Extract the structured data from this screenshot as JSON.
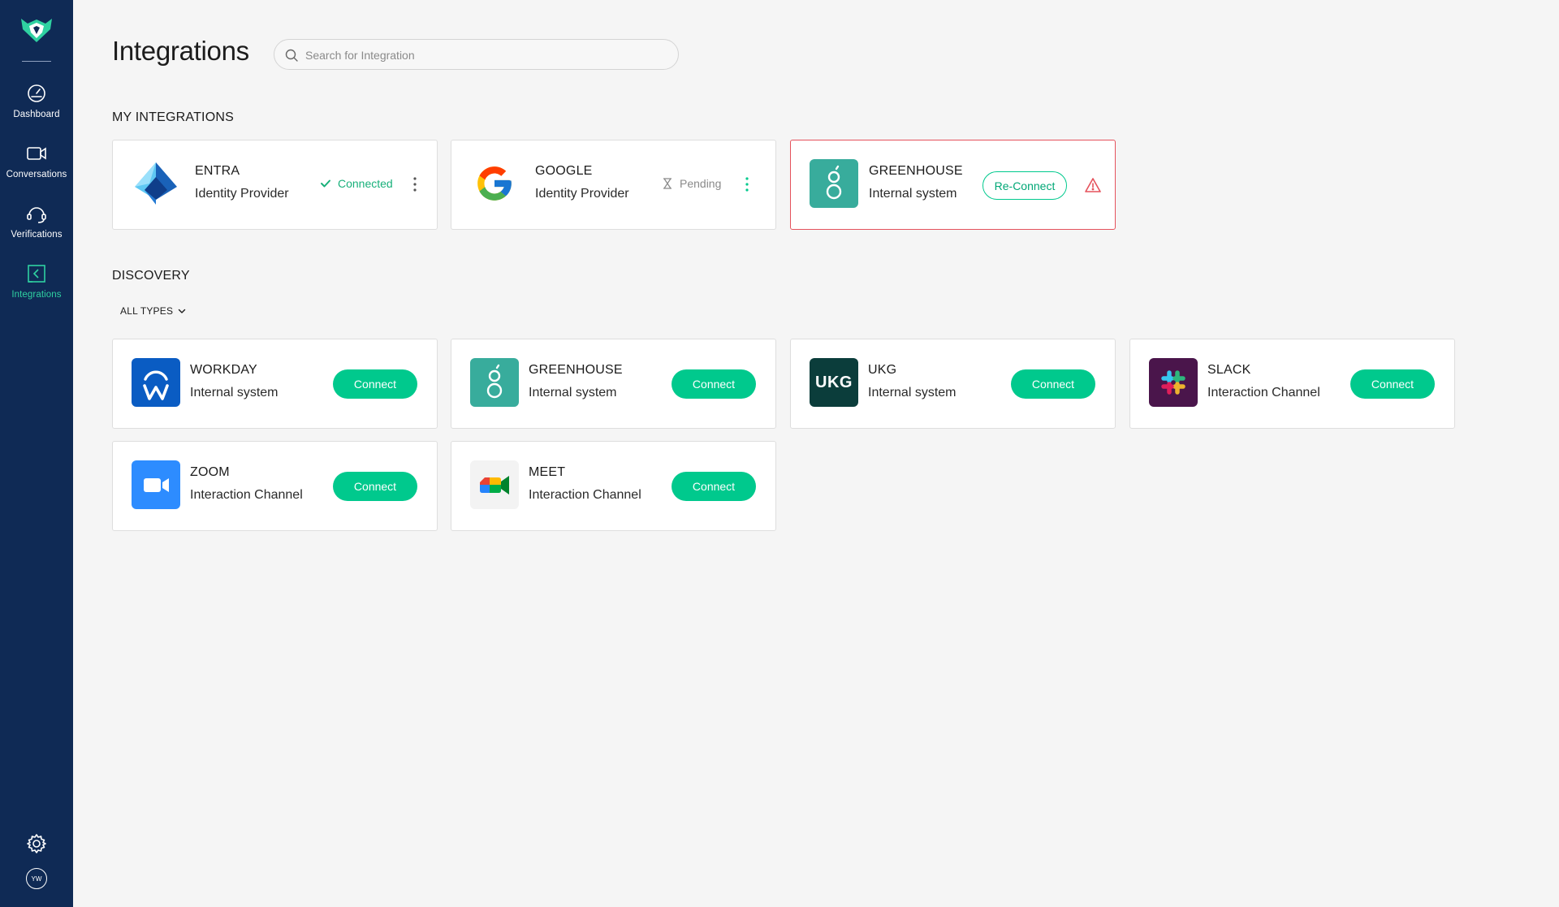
{
  "sidebar": {
    "items": [
      {
        "label": "Dashboard",
        "icon": "gauge-icon"
      },
      {
        "label": "Conversations",
        "icon": "video-camera-icon"
      },
      {
        "label": "Verifications",
        "icon": "headset-icon"
      },
      {
        "label": "Integrations",
        "icon": "integrations-icon",
        "active": true
      }
    ],
    "avatar_initials": "YW"
  },
  "header": {
    "title": "Integrations",
    "search_placeholder": "Search for Integration"
  },
  "my_integrations": {
    "title": "MY INTEGRATIONS",
    "cards": [
      {
        "name": "ENTRA",
        "type": "Identity Provider",
        "status": "Connected"
      },
      {
        "name": "GOOGLE",
        "type": "Identity Provider",
        "status": "Pending"
      },
      {
        "name": "GREENHOUSE",
        "type": "Internal system",
        "action": "Re-Connect"
      }
    ]
  },
  "discovery": {
    "title": "DISCOVERY",
    "filter_label": "ALL TYPES",
    "connect_label": "Connect",
    "cards": [
      {
        "name": "WORKDAY",
        "type": "Internal system"
      },
      {
        "name": "GREENHOUSE",
        "type": "Internal system"
      },
      {
        "name": "UKG",
        "type": "Internal system",
        "logo_text": "UKG"
      },
      {
        "name": "SLACK",
        "type": "Interaction Channel"
      },
      {
        "name": "ZOOM",
        "type": "Interaction Channel"
      },
      {
        "name": "MEET",
        "type": "Interaction Channel"
      }
    ]
  },
  "colors": {
    "sidebar": "#0f2a55",
    "accent": "#00c98d",
    "active_nav": "#2fd1a1",
    "error": "#e5525c",
    "background": "#f5f5f5"
  }
}
